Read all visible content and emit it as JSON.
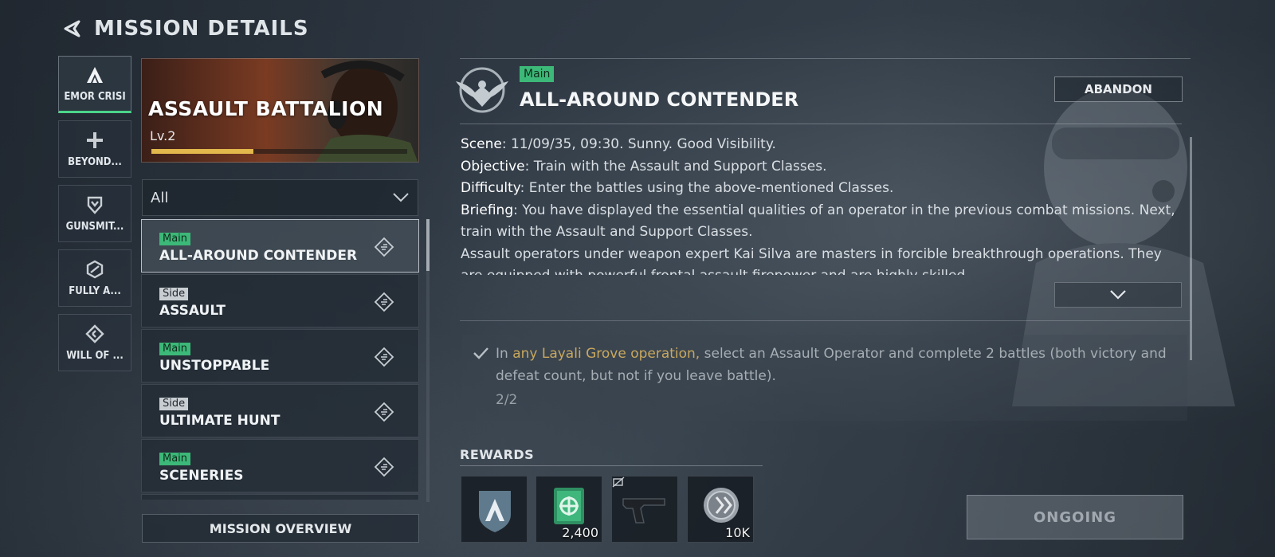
{
  "header": {
    "title": "MISSION DETAILS"
  },
  "categories": [
    {
      "label": "EMOR CRISI",
      "icon": "a-logo-icon",
      "active": true
    },
    {
      "label": "BEYOND...",
      "icon": "plus-icon",
      "active": false
    },
    {
      "label": "GUNSMIT...",
      "icon": "shield-chevron-icon",
      "active": false
    },
    {
      "label": "FULLY A...",
      "icon": "hexagon-slash-icon",
      "active": false
    },
    {
      "label": "WILL OF ...",
      "icon": "diamond-arrows-icon",
      "active": false
    }
  ],
  "banner": {
    "title": "ASSAULT BATTALION",
    "level": "Lv.2",
    "progress": 0.4
  },
  "filter": {
    "value": "All"
  },
  "missions": [
    {
      "tag": "Main",
      "name": "ALL-AROUND CONTENDER",
      "active": true
    },
    {
      "tag": "Side",
      "name": "ASSAULT",
      "active": false
    },
    {
      "tag": "Main",
      "name": "UNSTOPPABLE",
      "active": false
    },
    {
      "tag": "Side",
      "name": "ULTIMATE HUNT",
      "active": false
    },
    {
      "tag": "Main",
      "name": "SCENERIES",
      "active": false
    }
  ],
  "overview_label": "MISSION OVERVIEW",
  "detail": {
    "tag": "Main",
    "title": "ALL-AROUND CONTENDER",
    "abandon_label": "ABANDON",
    "description": [
      {
        "label": "Scene",
        "text": ": 11/09/35, 09:30. Sunny. Good Visibility."
      },
      {
        "label": "Objective",
        "text": ": Train with the Assault and Support Classes."
      },
      {
        "label": "Difficulty",
        "text": ": Enter the battles using the above-mentioned Classes."
      },
      {
        "label": "Briefing",
        "text": ": You have displayed the essential qualities of an operator in the previous combat missions. Next, train with the Assault and Support Classes."
      },
      {
        "label": "",
        "text": "Assault operators under weapon expert Kai Silva are masters in forcible breakthrough operations. They are equipped with powerful frontal assault firepower and are highly skilled"
      }
    ],
    "objective": {
      "prefix": "In ",
      "highlight": "any Layali Grove operation,",
      "suffix": " select an Assault Operator and complete 2 battles (both victory and defeat count, but not if you leave battle).",
      "progress": "2/2"
    }
  },
  "rewards": {
    "title": "REWARDS",
    "items": [
      {
        "icon": "battalion-badge-icon",
        "qty": ""
      },
      {
        "icon": "supply-crate-icon",
        "qty": "2,400"
      },
      {
        "icon": "pistol-icon",
        "qty": ""
      },
      {
        "icon": "coin-icon",
        "qty": "10K"
      }
    ]
  },
  "status_label": "ONGOING",
  "colors": {
    "accent_green": "#3cb878",
    "highlight_gold": "#c9a85e",
    "progress_gold": "#e2b84c"
  }
}
